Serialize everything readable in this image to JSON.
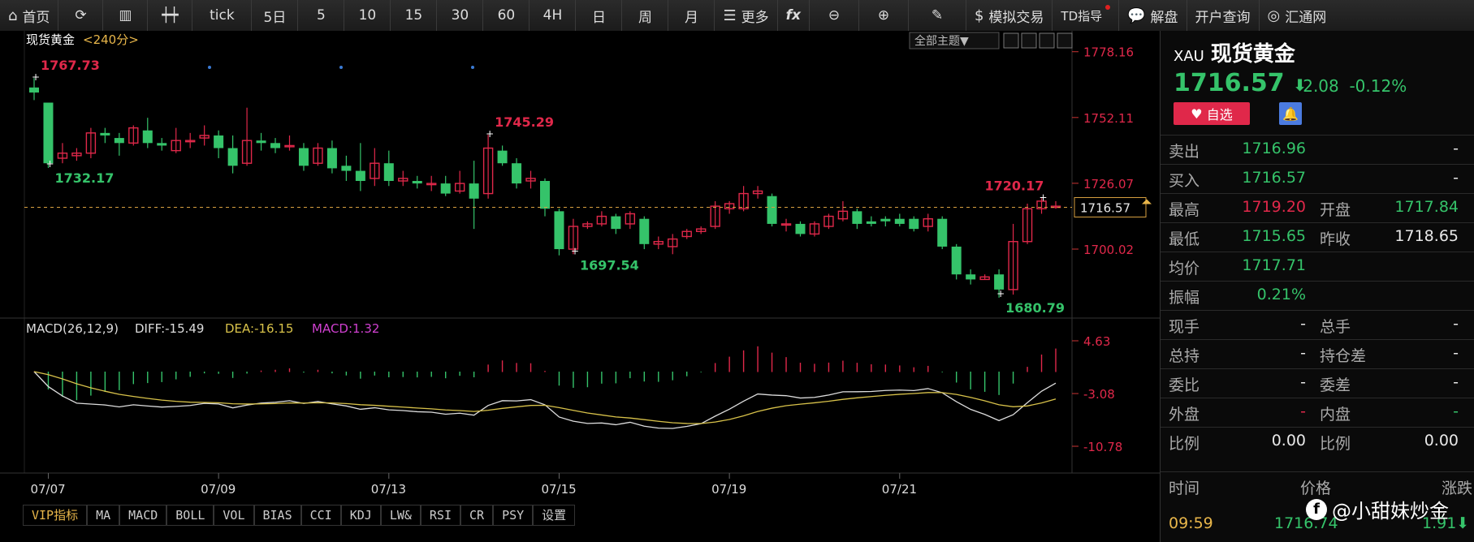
{
  "toolbar": {
    "home": "首页",
    "tick": "tick",
    "periods": [
      "5日",
      "5",
      "10",
      "15",
      "30",
      "60",
      "4H",
      "日",
      "周",
      "月"
    ],
    "more": "更多",
    "fx": "fx",
    "sim_trade": "模拟交易",
    "td_guide": "TD指导",
    "analysis": "解盘",
    "account_query": "开户查询",
    "brand": "汇通网"
  },
  "chart_header": {
    "name": "现货黄金",
    "period": "<240分>",
    "theme": "全部主题▼"
  },
  "macd": {
    "label": "MACD(26,12,9)",
    "diff": "DIFF:-15.49",
    "dea": "DEA:-16.15",
    "macd": "MACD:1.32",
    "axis": [
      "4.63",
      "-3.08",
      "-10.78"
    ]
  },
  "bottom_tabs": [
    "VIP指标",
    "MA",
    "MACD",
    "BOLL",
    "VOL",
    "BIAS",
    "CCI",
    "KDJ",
    "LW&",
    "RSI",
    "CR",
    "PSY",
    "设置"
  ],
  "chart_data": {
    "type": "candlestick",
    "y_axis": [
      "1778.16",
      "1752.11",
      "1726.07",
      "1700.02"
    ],
    "ylim": [
      1674,
      1780
    ],
    "x_labels": [
      "07/07",
      "07/09",
      "07/13",
      "07/15",
      "07/19",
      "07/21"
    ],
    "current_price": "1716.57",
    "annotations": [
      {
        "text": "1767.73",
        "idx": 0,
        "price": 1767.73,
        "kind": "high"
      },
      {
        "text": "1732.17",
        "idx": 1,
        "price": 1732.17,
        "kind": "low"
      },
      {
        "text": "1745.29",
        "idx": 32,
        "price": 1745.29,
        "kind": "high"
      },
      {
        "text": "1697.54",
        "idx": 38,
        "price": 1697.54,
        "kind": "low"
      },
      {
        "text": "1680.79",
        "idx": 68,
        "price": 1680.79,
        "kind": "low"
      },
      {
        "text": "1720.17",
        "idx": 71,
        "price": 1720.17,
        "kind": "high"
      }
    ],
    "candles": [
      [
        1764,
        1762,
        1767.73,
        1759
      ],
      [
        1758,
        1734,
        1758,
        1732.17
      ],
      [
        1736,
        1738,
        1742,
        1734
      ],
      [
        1737,
        1738,
        1740,
        1735
      ],
      [
        1738,
        1746,
        1748,
        1736
      ],
      [
        1746,
        1745,
        1748,
        1742
      ],
      [
        1744,
        1742,
        1746,
        1737
      ],
      [
        1742,
        1748,
        1749,
        1741
      ],
      [
        1747,
        1742,
        1752,
        1740
      ],
      [
        1742,
        1741,
        1744,
        1739
      ],
      [
        1739,
        1743,
        1748,
        1738
      ],
      [
        1743,
        1743,
        1746,
        1740
      ],
      [
        1744,
        1745,
        1749,
        1741
      ],
      [
        1745,
        1740,
        1747,
        1736
      ],
      [
        1740,
        1733,
        1745,
        1730
      ],
      [
        1734,
        1743,
        1756,
        1733
      ],
      [
        1743,
        1742,
        1746,
        1739
      ],
      [
        1742,
        1740,
        1744,
        1738
      ],
      [
        1741,
        1741,
        1745,
        1739
      ],
      [
        1740,
        1733,
        1742,
        1731
      ],
      [
        1734,
        1740,
        1742,
        1733
      ],
      [
        1740,
        1732,
        1743,
        1730
      ],
      [
        1733,
        1731,
        1737,
        1727
      ],
      [
        1731,
        1727,
        1742,
        1723
      ],
      [
        1728,
        1734,
        1740,
        1725
      ],
      [
        1734,
        1727,
        1739,
        1725
      ],
      [
        1727,
        1728,
        1731,
        1725
      ],
      [
        1727,
        1726,
        1729,
        1724
      ],
      [
        1726,
        1726,
        1729,
        1723
      ],
      [
        1726,
        1722,
        1729,
        1721
      ],
      [
        1723,
        1726,
        1731,
        1722
      ],
      [
        1726,
        1720,
        1735,
        1708
      ],
      [
        1722,
        1740,
        1745.29,
        1720
      ],
      [
        1739,
        1734,
        1741,
        1733
      ],
      [
        1734,
        1726,
        1736,
        1724
      ],
      [
        1727,
        1728,
        1731,
        1724
      ],
      [
        1727,
        1716,
        1728,
        1713
      ],
      [
        1715,
        1700,
        1716,
        1697.54
      ],
      [
        1700,
        1709,
        1712,
        1698
      ],
      [
        1709,
        1710,
        1711,
        1708
      ],
      [
        1710,
        1713,
        1715,
        1709
      ],
      [
        1713,
        1708,
        1714,
        1706
      ],
      [
        1710,
        1714,
        1715,
        1708
      ],
      [
        1712,
        1702,
        1713,
        1700
      ],
      [
        1702,
        1703,
        1705,
        1700
      ],
      [
        1701,
        1704,
        1706,
        1698
      ],
      [
        1705,
        1707,
        1708,
        1704
      ],
      [
        1707,
        1708,
        1709,
        1706
      ],
      [
        1709,
        1717,
        1719,
        1708
      ],
      [
        1716,
        1718,
        1719,
        1714
      ],
      [
        1716,
        1722,
        1725,
        1715
      ],
      [
        1722,
        1723,
        1725,
        1720
      ],
      [
        1721,
        1710,
        1722,
        1709
      ],
      [
        1710,
        1710,
        1712,
        1707
      ],
      [
        1710,
        1706,
        1711,
        1705
      ],
      [
        1706,
        1710,
        1711,
        1705
      ],
      [
        1709,
        1713,
        1714,
        1708
      ],
      [
        1712,
        1715,
        1719,
        1711
      ],
      [
        1715,
        1710,
        1716,
        1708
      ],
      [
        1711,
        1710,
        1713,
        1709
      ],
      [
        1712,
        1711,
        1713,
        1709
      ],
      [
        1712,
        1710,
        1714,
        1709
      ],
      [
        1712,
        1708,
        1713,
        1707
      ],
      [
        1709,
        1712,
        1714,
        1707
      ],
      [
        1712,
        1701,
        1713,
        1700
      ],
      [
        1701,
        1690,
        1702,
        1688
      ],
      [
        1690,
        1688,
        1692,
        1686
      ],
      [
        1688,
        1689,
        1690,
        1688
      ],
      [
        1690,
        1684,
        1692,
        1680.79
      ],
      [
        1684,
        1703,
        1710,
        1682
      ],
      [
        1703,
        1716,
        1718,
        1702
      ],
      [
        1716,
        1719,
        1720.17,
        1714
      ],
      [
        1717,
        1717,
        1719,
        1716
      ]
    ]
  },
  "side": {
    "code": "XAU",
    "name": "现货黄金",
    "price": "1716.57",
    "arrow": "⬇",
    "change": "-2.08",
    "change_pct": "-0.12%",
    "fav": "自选",
    "rows": [
      {
        "l1": "卖出",
        "v1": "1716.96",
        "c1": "green",
        "l2": "",
        "v2": "-",
        "c2": "white"
      },
      {
        "l1": "买入",
        "v1": "1716.57",
        "c1": "green",
        "l2": "",
        "v2": "-",
        "c2": "white"
      },
      {
        "l1": "最高",
        "v1": "1719.20",
        "c1": "red",
        "l2": "开盘",
        "v2": "1717.84",
        "c2": "green"
      },
      {
        "l1": "最低",
        "v1": "1715.65",
        "c1": "green",
        "l2": "昨收",
        "v2": "1718.65",
        "c2": "white"
      },
      {
        "l1": "均价",
        "v1": "1717.71",
        "c1": "green",
        "l2": "",
        "v2": "",
        "c2": "white"
      },
      {
        "l1": "振幅",
        "v1": "0.21%",
        "c1": "green",
        "l2": "",
        "v2": "",
        "c2": "white"
      },
      {
        "l1": "现手",
        "v1": "-",
        "c1": "white",
        "l2": "总手",
        "v2": "-",
        "c2": "white"
      },
      {
        "l1": "总持",
        "v1": "-",
        "c1": "white",
        "l2": "持仓差",
        "v2": "-",
        "c2": "white"
      },
      {
        "l1": "委比",
        "v1": "-",
        "c1": "white",
        "l2": "委差",
        "v2": "-",
        "c2": "white"
      },
      {
        "l1": "外盘",
        "v1": "-",
        "c1": "red",
        "l2": "内盘",
        "v2": "-",
        "c2": "green"
      },
      {
        "l1": "比例",
        "v1": "0.00",
        "c1": "white",
        "l2": "比例",
        "v2": "0.00",
        "c2": "white"
      }
    ],
    "trade_header": [
      "时间",
      "价格",
      "涨跌"
    ],
    "trade_row": {
      "time": "09:59",
      "price": "1716.74",
      "chg": "1.91⬇"
    }
  },
  "watermark": "@小甜妹炒金",
  "colors": {
    "up": "#e0284a",
    "down": "#35c36a",
    "macd_white": "#dddddd",
    "macd_yellow": "#d8c24a"
  }
}
